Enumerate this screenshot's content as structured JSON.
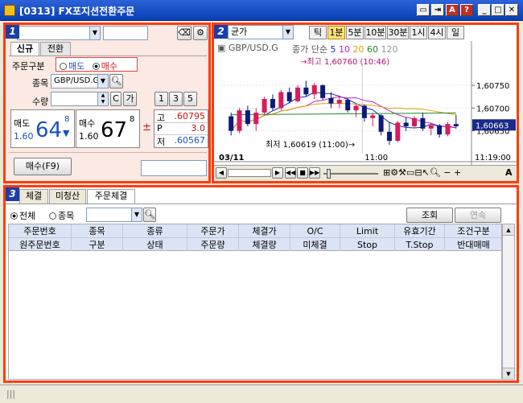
{
  "window": {
    "title": "[0313] FX포지션전환주문",
    "buttons": [
      "▭",
      "⇥",
      "A",
      "?",
      "_",
      "□",
      "✕"
    ]
  },
  "panel1": {
    "number": "1",
    "account_value": "",
    "account_name": "",
    "tabs": [
      "신규",
      "전환"
    ],
    "order_type_label": "주문구분",
    "sell_radio": "매도",
    "buy_radio": "매수",
    "symbol_label": "종목",
    "symbol_value": "GBP/USD.G",
    "qty_label": "수량",
    "qty_value": "",
    "c_button": "C",
    "ga_button": "가",
    "qty_presets": [
      "1",
      "3",
      "5"
    ],
    "sell_quote": {
      "label": "매도",
      "small": "1.60",
      "big": "64",
      "pip": "8",
      "arrow": "▼"
    },
    "buy_quote": {
      "label": "매수",
      "small": "1.60",
      "big": "67",
      "pip": "8"
    },
    "spread_symbol": "±",
    "high": {
      "label": "고",
      "value": ".60795"
    },
    "p": {
      "label": "P",
      "value": "3.0"
    },
    "low": {
      "label": "저",
      "value": ".60567"
    },
    "order_button": "매수(F9)",
    "order_field": ""
  },
  "panel2": {
    "number": "2",
    "price_type": "균가",
    "periods": [
      "틱",
      "1분",
      "5분",
      "10분",
      "30분",
      "1시",
      "4시",
      "일"
    ],
    "active_period": "1분",
    "legend_symbol": "GBP/USD.G",
    "legend_ma": "종가 단순",
    "ma_periods": [
      "5",
      "10",
      "20",
      "60",
      "120"
    ],
    "ma_colors": [
      "#1e2aa8",
      "#c020c0",
      "#e0a000",
      "#228b22",
      "#999999"
    ],
    "high_note": "최고 1,60760 (10:46)",
    "low_note": "최저 1,60619 (11:00)",
    "x_labels": [
      "03/11",
      "11:00",
      "11:19:00"
    ],
    "y_labels": [
      "1,60750",
      "1,60700",
      "1,60650"
    ],
    "current_price": "1,60663",
    "toolbar_a": "A"
  },
  "chart_data": {
    "type": "line",
    "title": "",
    "xlabel": "",
    "ylabel": "",
    "ylim": [
      1.606,
      1.6078
    ],
    "x_ticks": [
      "03/11",
      "11:00",
      "11:19:00"
    ],
    "y_ticks": [
      1.6075,
      1.607,
      1.6065
    ],
    "current_price": 1.60663,
    "high": 1.6076,
    "low": 1.60619,
    "candles": [
      {
        "o": 1.60682,
        "h": 1.6069,
        "l": 1.6064,
        "c": 1.6065
      },
      {
        "o": 1.6065,
        "h": 1.607,
        "l": 1.60645,
        "c": 1.60695
      },
      {
        "o": 1.60695,
        "h": 1.60705,
        "l": 1.6066,
        "c": 1.60665
      },
      {
        "o": 1.60665,
        "h": 1.607,
        "l": 1.6065,
        "c": 1.6069
      },
      {
        "o": 1.6069,
        "h": 1.60725,
        "l": 1.60685,
        "c": 1.6072
      },
      {
        "o": 1.6072,
        "h": 1.6073,
        "l": 1.60695,
        "c": 1.607
      },
      {
        "o": 1.607,
        "h": 1.6074,
        "l": 1.60695,
        "c": 1.60735
      },
      {
        "o": 1.60735,
        "h": 1.60745,
        "l": 1.6071,
        "c": 1.60715
      },
      {
        "o": 1.60715,
        "h": 1.6075,
        "l": 1.60712,
        "c": 1.60745
      },
      {
        "o": 1.60745,
        "h": 1.6076,
        "l": 1.60725,
        "c": 1.6073
      },
      {
        "o": 1.6073,
        "h": 1.60755,
        "l": 1.6072,
        "c": 1.6075
      },
      {
        "o": 1.6075,
        "h": 1.60752,
        "l": 1.60718,
        "c": 1.60722
      },
      {
        "o": 1.60722,
        "h": 1.60735,
        "l": 1.607,
        "c": 1.6071
      },
      {
        "o": 1.6071,
        "h": 1.60725,
        "l": 1.607,
        "c": 1.60718
      },
      {
        "o": 1.60718,
        "h": 1.60722,
        "l": 1.6069,
        "c": 1.60695
      },
      {
        "o": 1.60695,
        "h": 1.6071,
        "l": 1.6068,
        "c": 1.60705
      },
      {
        "o": 1.60705,
        "h": 1.60708,
        "l": 1.6067,
        "c": 1.60678
      },
      {
        "o": 1.60678,
        "h": 1.6069,
        "l": 1.6066,
        "c": 1.60684
      },
      {
        "o": 1.60684,
        "h": 1.60686,
        "l": 1.6064,
        "c": 1.60648
      },
      {
        "o": 1.60648,
        "h": 1.6067,
        "l": 1.60619,
        "c": 1.60628
      },
      {
        "o": 1.60628,
        "h": 1.60672,
        "l": 1.60625,
        "c": 1.60668
      },
      {
        "o": 1.60668,
        "h": 1.6068,
        "l": 1.6065,
        "c": 1.6066
      },
      {
        "o": 1.6066,
        "h": 1.60682,
        "l": 1.60655,
        "c": 1.60678
      },
      {
        "o": 1.60678,
        "h": 1.6069,
        "l": 1.6065,
        "c": 1.60655
      },
      {
        "o": 1.60655,
        "h": 1.60668,
        "l": 1.6064,
        "c": 1.60662
      },
      {
        "o": 1.60662,
        "h": 1.60665,
        "l": 1.60635,
        "c": 1.60642
      },
      {
        "o": 1.60642,
        "h": 1.6067,
        "l": 1.60638,
        "c": 1.60665
      },
      {
        "o": 1.60665,
        "h": 1.60685,
        "l": 1.60655,
        "c": 1.6066
      }
    ]
  },
  "panel3": {
    "number": "3",
    "tabs": [
      "체결",
      "미청산",
      "주문체결"
    ],
    "active_tab": "주문체결",
    "filter_all": "전체",
    "filter_symbol": "종목",
    "filter_value": "",
    "query_button": "조회",
    "continue_button": "연속",
    "header_row1": [
      "주문번호",
      "종목",
      "종류",
      "주문가",
      "체결가",
      "O/C",
      "Limit",
      "유효기간",
      "조건구분"
    ],
    "header_row2": [
      "원주문번호",
      "구분",
      "상태",
      "주문량",
      "체결량",
      "미체결",
      "Stop",
      "T.Stop",
      "반대매매"
    ]
  },
  "status": {
    "text": "|||"
  }
}
